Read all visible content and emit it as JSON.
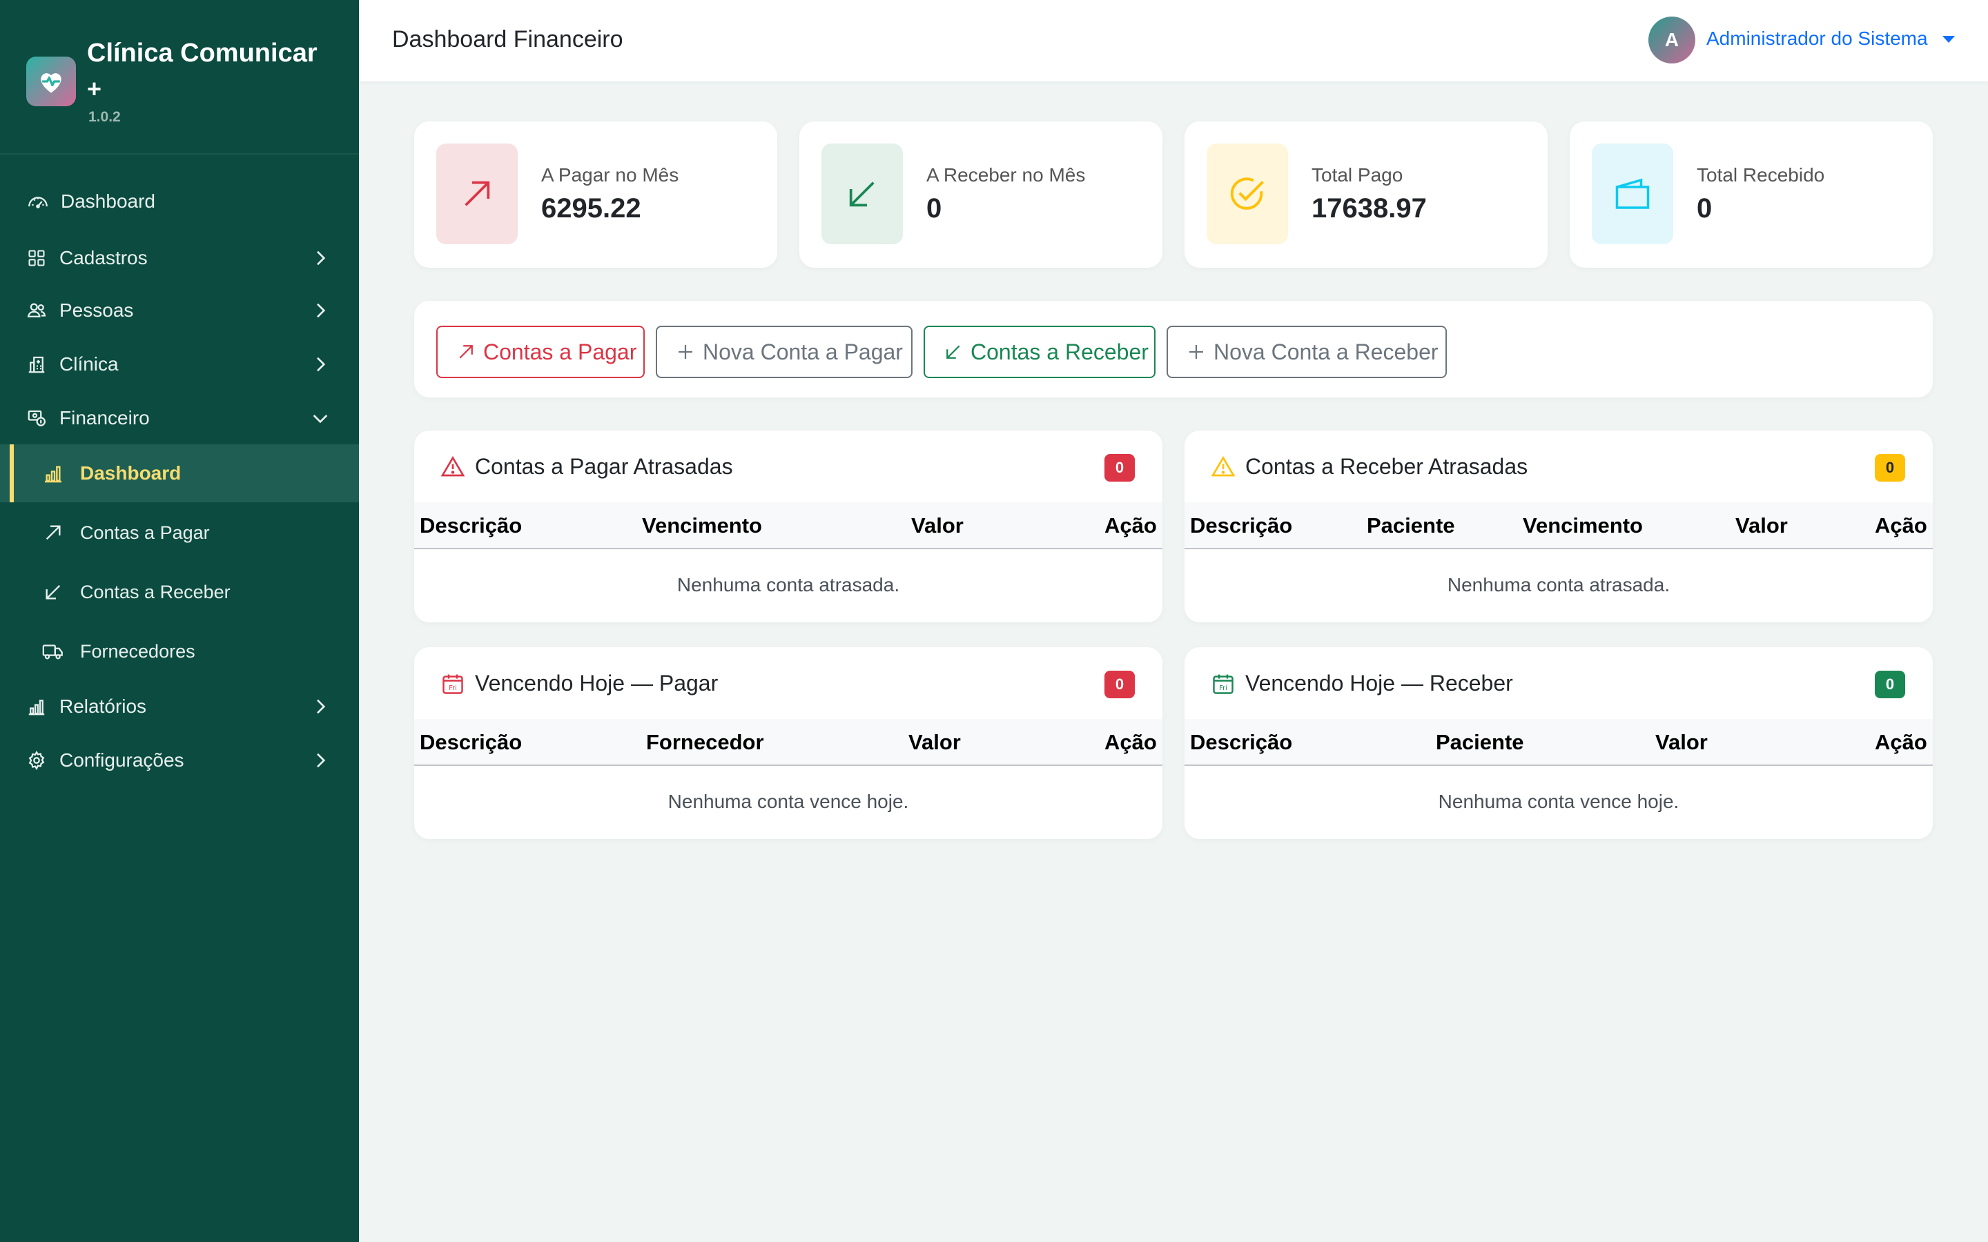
{
  "brand": {
    "name": "Clínica Comunicar",
    "plus": "+",
    "version": "1.0.2"
  },
  "sidebar": {
    "items": [
      {
        "label": "Dashboard",
        "icon": "speedometer-icon"
      },
      {
        "label": "Cadastros",
        "icon": "grid-icon"
      },
      {
        "label": "Pessoas",
        "icon": "people-icon"
      },
      {
        "label": "Clínica",
        "icon": "hospital-icon"
      },
      {
        "label": "Financeiro",
        "icon": "cash-coin-icon",
        "expanded": true
      },
      {
        "label": "Dashboard",
        "icon": "bar-chart-icon",
        "active": true
      },
      {
        "label": "Contas a Pagar",
        "icon": "arrow-up-right-icon"
      },
      {
        "label": "Contas a Receber",
        "icon": "arrow-down-left-icon"
      },
      {
        "label": "Fornecedores",
        "icon": "truck-icon"
      },
      {
        "label": "Relatórios",
        "icon": "bar-chart-icon"
      },
      {
        "label": "Configurações",
        "icon": "gear-icon"
      }
    ]
  },
  "topbar": {
    "title": "Dashboard Financeiro",
    "user_initial": "A",
    "user_name": "Administrador do Sistema"
  },
  "stats": [
    {
      "label": "A Pagar no Mês",
      "value": "6295.22",
      "icon": "arrow-up-right-icon",
      "color": "#dc3545",
      "bg": "#f8e1e3"
    },
    {
      "label": "A Receber no Mês",
      "value": "0",
      "icon": "arrow-down-left-icon",
      "color": "#198754",
      "bg": "#e3f1ea"
    },
    {
      "label": "Total Pago",
      "value": "17638.97",
      "icon": "check-circle-icon",
      "color": "#ffc107",
      "bg": "#fff6dc"
    },
    {
      "label": "Total Recebido",
      "value": "0",
      "icon": "wallet-icon",
      "color": "#0dcaf0",
      "bg": "#e1f7fb"
    }
  ],
  "actions": {
    "contas_pagar": "Contas a Pagar",
    "nova_pagar": "Nova Conta a Pagar",
    "contas_receber": "Contas a Receber",
    "nova_receber": "Nova Conta a Receber"
  },
  "panels": {
    "pagar_atrasadas": {
      "title": "Contas a Pagar Atrasadas",
      "count": "0",
      "columns": [
        "Descrição",
        "Vencimento",
        "Valor",
        "Ação"
      ],
      "empty": "Nenhuma conta atrasada."
    },
    "receber_atrasadas": {
      "title": "Contas a Receber Atrasadas",
      "count": "0",
      "columns": [
        "Descrição",
        "Paciente",
        "Vencimento",
        "Valor",
        "Ação"
      ],
      "empty": "Nenhuma conta atrasada."
    },
    "hoje_pagar": {
      "title": "Vencendo Hoje — Pagar",
      "count": "0",
      "columns": [
        "Descrição",
        "Fornecedor",
        "Valor",
        "Ação"
      ],
      "empty": "Nenhuma conta vence hoje.",
      "calendar_day": "Fri"
    },
    "hoje_receber": {
      "title": "Vencendo Hoje — Receber",
      "count": "0",
      "columns": [
        "Descrição",
        "Paciente",
        "Valor",
        "Ação"
      ],
      "empty": "Nenhuma conta vence hoje.",
      "calendar_day": "Fri"
    }
  }
}
